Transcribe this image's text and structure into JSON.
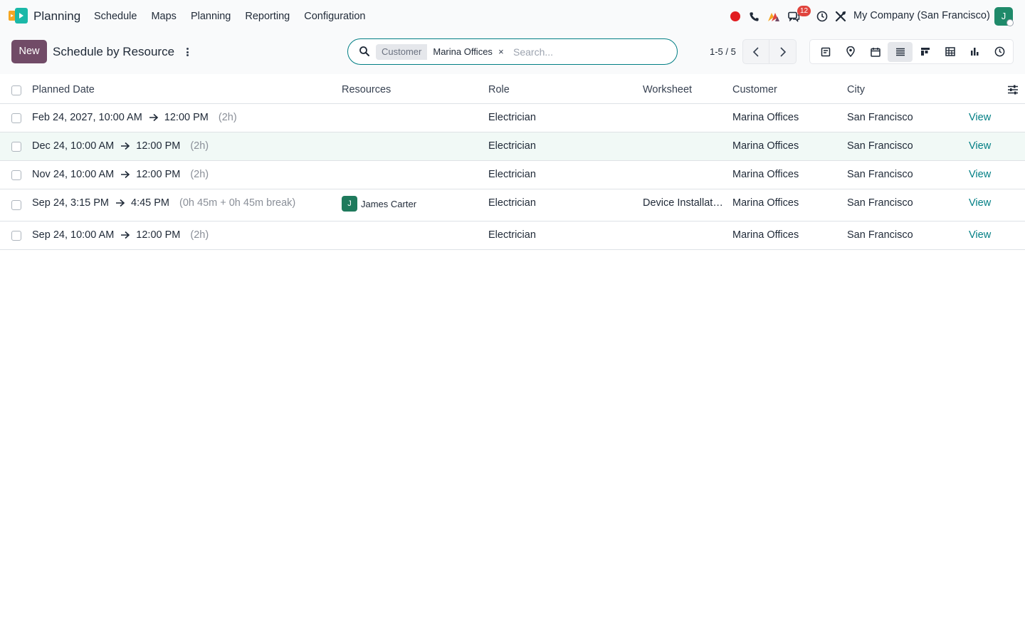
{
  "app": {
    "name": "Planning"
  },
  "menu": [
    "Schedule",
    "Maps",
    "Planning",
    "Reporting",
    "Configuration"
  ],
  "systray": {
    "messages_count": "12",
    "company": "My Company (San Francisco)",
    "user_initial": "J",
    "icons": [
      "record-icon",
      "phone-icon",
      "activity-icon",
      "messages-icon",
      "clock-icon",
      "tools-icon"
    ]
  },
  "control": {
    "new_label": "New",
    "title": "Schedule by Resource",
    "search": {
      "facet_label": "Customer",
      "facet_value": "Marina Offices",
      "facet_remove": "×",
      "placeholder": "Search..."
    },
    "pager": "1-5 / 5",
    "views": [
      "form",
      "map",
      "calendar",
      "list",
      "gantt",
      "pivot",
      "graph",
      "activity"
    ],
    "active_view": "list"
  },
  "table": {
    "headers": {
      "planned_date": "Planned Date",
      "resources": "Resources",
      "role": "Role",
      "worksheet": "Worksheet",
      "customer": "Customer",
      "city": "City"
    },
    "rows": [
      {
        "start": "Feb 24, 2027, 10:00 AM",
        "end": "12:00 PM",
        "duration": "(2h)",
        "resource_initial": "",
        "resource": "",
        "role": "Electrician",
        "worksheet": "",
        "customer": "Marina Offices",
        "city": "San Francisco",
        "action": "View"
      },
      {
        "start": "Dec 24, 10:00 AM",
        "end": "12:00 PM",
        "duration": "(2h)",
        "resource_initial": "",
        "resource": "",
        "role": "Electrician",
        "worksheet": "",
        "customer": "Marina Offices",
        "city": "San Francisco",
        "action": "View"
      },
      {
        "start": "Nov 24, 10:00 AM",
        "end": "12:00 PM",
        "duration": "(2h)",
        "resource_initial": "",
        "resource": "",
        "role": "Electrician",
        "worksheet": "",
        "customer": "Marina Offices",
        "city": "San Francisco",
        "action": "View"
      },
      {
        "start": "Sep 24, 3:15 PM",
        "end": "4:45 PM",
        "duration": "(0h 45m + 0h 45m break)",
        "resource_initial": "J",
        "resource": "James Carter",
        "role": "Electrician",
        "worksheet": "Device Installati…",
        "customer": "Marina Offices",
        "city": "San Francisco",
        "action": "View"
      },
      {
        "start": "Sep 24, 10:00 AM",
        "end": "12:00 PM",
        "duration": "(2h)",
        "resource_initial": "",
        "resource": "",
        "role": "Electrician",
        "worksheet": "",
        "customer": "Marina Offices",
        "city": "San Francisco",
        "action": "View"
      }
    ]
  },
  "colors": {
    "brand_primary": "#714b67",
    "accent_teal": "#017e84",
    "badge_red": "#e0443d",
    "record_red": "#e11d21",
    "avatar_green": "#1f7a5c"
  }
}
